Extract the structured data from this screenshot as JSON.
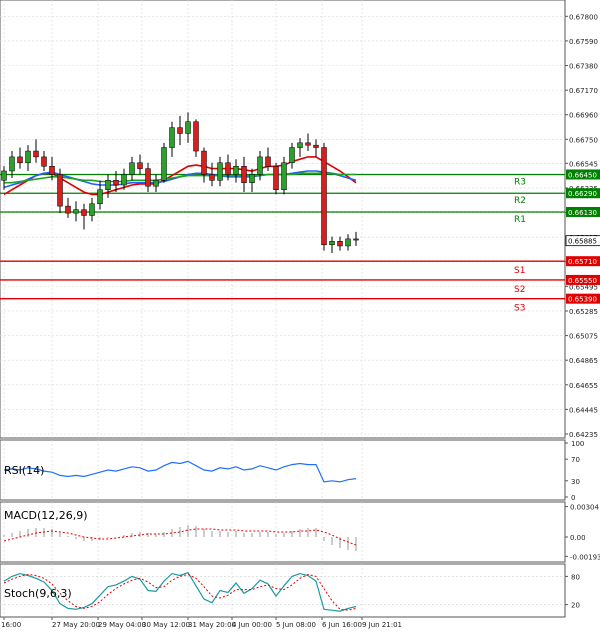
{
  "chart_data": {
    "type": "candlestick",
    "instrument_note": "",
    "price_axis": {
      "ticks": [
        "0.67800",
        "0.67590",
        "0.67380",
        "0.67170",
        "0.66960",
        "0.66750",
        "0.66545",
        "0.66335",
        "0.66125",
        "0.65915",
        "0.65705",
        "0.65495",
        "0.65285",
        "0.65075",
        "0.64865",
        "0.64655",
        "0.64445",
        "0.64235"
      ],
      "range": [
        0.64235,
        0.67905
      ],
      "current_price": "0.65885"
    },
    "levels": [
      {
        "label": "R3",
        "value": "0.66450",
        "color": "#008000"
      },
      {
        "label": "R2",
        "value": "0.66290",
        "color": "#008000"
      },
      {
        "label": "R1",
        "value": "0.66130",
        "color": "#008000"
      },
      {
        "label": "S1",
        "value": "0.65710",
        "color": "#e00000"
      },
      {
        "label": "S2",
        "value": "0.65550",
        "color": "#e00000"
      },
      {
        "label": "S3",
        "value": "0.65390",
        "color": "#e00000"
      }
    ],
    "time_axis": [
      "16:00",
      "27 May 20:00",
      "29 May 04:00",
      "30 May 12:00",
      "31 May 20:00",
      "4 Jun 00:00",
      "5 Jun 08:00",
      "6 Jun 16:00",
      "9 Jun 21:01"
    ],
    "candles": [
      [
        0.664,
        0.6652,
        0.6632,
        0.6648
      ],
      [
        0.6648,
        0.6665,
        0.6642,
        0.666
      ],
      [
        0.666,
        0.6668,
        0.665,
        0.6655
      ],
      [
        0.6655,
        0.667,
        0.6648,
        0.6665
      ],
      [
        0.6665,
        0.6675,
        0.6655,
        0.666
      ],
      [
        0.666,
        0.6665,
        0.6648,
        0.6652
      ],
      [
        0.6652,
        0.666,
        0.664,
        0.6645
      ],
      [
        0.6645,
        0.665,
        0.6612,
        0.6618
      ],
      [
        0.6618,
        0.6625,
        0.6608,
        0.6612
      ],
      [
        0.6612,
        0.6622,
        0.6605,
        0.6615
      ],
      [
        0.6615,
        0.662,
        0.6598,
        0.661
      ],
      [
        0.661,
        0.6625,
        0.6605,
        0.662
      ],
      [
        0.662,
        0.664,
        0.6615,
        0.6632
      ],
      [
        0.6632,
        0.6645,
        0.6625,
        0.664
      ],
      [
        0.664,
        0.6648,
        0.663,
        0.6636
      ],
      [
        0.6636,
        0.665,
        0.6632,
        0.6645
      ],
      [
        0.6645,
        0.666,
        0.664,
        0.6655
      ],
      [
        0.6655,
        0.6662,
        0.6645,
        0.665
      ],
      [
        0.665,
        0.6655,
        0.663,
        0.6635
      ],
      [
        0.6635,
        0.6645,
        0.663,
        0.664
      ],
      [
        0.664,
        0.6672,
        0.6638,
        0.6668
      ],
      [
        0.6668,
        0.669,
        0.666,
        0.6685
      ],
      [
        0.6685,
        0.6695,
        0.667,
        0.668
      ],
      [
        0.668,
        0.6698,
        0.6672,
        0.669
      ],
      [
        0.669,
        0.6692,
        0.666,
        0.6665
      ],
      [
        0.6665,
        0.6668,
        0.6638,
        0.6645
      ],
      [
        0.6645,
        0.6655,
        0.6635,
        0.664
      ],
      [
        0.664,
        0.666,
        0.6635,
        0.6655
      ],
      [
        0.6655,
        0.6662,
        0.664,
        0.6645
      ],
      [
        0.6645,
        0.6658,
        0.6638,
        0.6652
      ],
      [
        0.6652,
        0.666,
        0.663,
        0.6638
      ],
      [
        0.6638,
        0.665,
        0.663,
        0.6645
      ],
      [
        0.6645,
        0.6665,
        0.664,
        0.666
      ],
      [
        0.666,
        0.6668,
        0.6648,
        0.6652
      ],
      [
        0.6652,
        0.6655,
        0.6628,
        0.6632
      ],
      [
        0.6632,
        0.666,
        0.6628,
        0.6655
      ],
      [
        0.6655,
        0.6672,
        0.665,
        0.6668
      ],
      [
        0.6668,
        0.6676,
        0.666,
        0.6672
      ],
      [
        0.6672,
        0.668,
        0.6665,
        0.667
      ],
      [
        0.667,
        0.6675,
        0.666,
        0.6668
      ],
      [
        0.6668,
        0.6672,
        0.658,
        0.6585
      ],
      [
        0.6585,
        0.6592,
        0.6578,
        0.6588
      ],
      [
        0.6588,
        0.6592,
        0.658,
        0.6584
      ],
      [
        0.6584,
        0.6594,
        0.658,
        0.659
      ],
      [
        0.659,
        0.6596,
        0.6584,
        0.6589
      ]
    ],
    "moving_averages": [
      {
        "color": "#e00000",
        "values": [
          0.6628,
          0.6632,
          0.6636,
          0.664,
          0.6644,
          0.6646,
          0.6646,
          0.6642,
          0.6638,
          0.6634,
          0.663,
          0.6628,
          0.6628,
          0.663,
          0.6632,
          0.6634,
          0.6636,
          0.6637,
          0.6637,
          0.6637,
          0.664,
          0.6644,
          0.6648,
          0.6652,
          0.6653,
          0.6652,
          0.665,
          0.665,
          0.665,
          0.665,
          0.6649,
          0.6648,
          0.665,
          0.6652,
          0.6652,
          0.6653,
          0.6656,
          0.6658,
          0.666,
          0.666,
          0.6656,
          0.6652,
          0.6648,
          0.6643,
          0.6638
        ]
      },
      {
        "color": "#2060ff",
        "values": [
          0.6634,
          0.6636,
          0.6638,
          0.6641,
          0.6644,
          0.6646,
          0.6647,
          0.6645,
          0.6643,
          0.6641,
          0.6639,
          0.6637,
          0.6636,
          0.6636,
          0.6636,
          0.6637,
          0.6638,
          0.6638,
          0.6638,
          0.6638,
          0.6639,
          0.6641,
          0.6643,
          0.6645,
          0.6646,
          0.6646,
          0.6645,
          0.6644,
          0.6643,
          0.6643,
          0.6643,
          0.6643,
          0.6644,
          0.6645,
          0.6645,
          0.6645,
          0.6646,
          0.6647,
          0.6648,
          0.6648,
          0.6647,
          0.6646,
          0.6644,
          0.6642,
          0.664
        ]
      },
      {
        "color": "#20a020",
        "values": [
          0.6638,
          0.6638,
          0.6639,
          0.664,
          0.6641,
          0.6642,
          0.6643,
          0.6643,
          0.6642,
          0.6641,
          0.664,
          0.664,
          0.6639,
          0.6639,
          0.6639,
          0.6639,
          0.664,
          0.664,
          0.664,
          0.664,
          0.6641,
          0.6642,
          0.6643,
          0.6644,
          0.6644,
          0.6644,
          0.6644,
          0.6644,
          0.6644,
          0.6644,
          0.6644,
          0.6644,
          0.6644,
          0.6645,
          0.6645,
          0.6645,
          0.6645,
          0.6646,
          0.6646,
          0.6646,
          0.6646,
          0.6646,
          0.6645,
          0.6645,
          0.6645
        ]
      }
    ],
    "indicators": [
      {
        "name": "RSI(14)",
        "ticks": [
          "100",
          "70",
          "30",
          "0"
        ],
        "range": [
          0,
          100
        ],
        "color": "#2070ff",
        "values": [
          50,
          52,
          50,
          54,
          52,
          48,
          46,
          40,
          38,
          40,
          38,
          42,
          46,
          50,
          48,
          52,
          56,
          54,
          48,
          50,
          58,
          64,
          62,
          66,
          58,
          50,
          48,
          54,
          52,
          56,
          50,
          52,
          58,
          54,
          50,
          56,
          60,
          62,
          60,
          60,
          28,
          30,
          28,
          32,
          34
        ]
      },
      {
        "name": "MACD(12,26,9)",
        "ticks": [
          "0.00304",
          "0.00",
          "-0.001939"
        ],
        "range": [
          -0.0022,
          0.0032
        ],
        "hist_color": "#999999",
        "signal_color": "#e00000",
        "hist": [
          0.0002,
          0.0004,
          0.0006,
          0.0008,
          0.0009,
          0.0009,
          0.0008,
          0.0004,
          0.0001,
          -0.0002,
          -0.0004,
          -0.0004,
          -0.0003,
          -0.0001,
          0.0,
          0.0002,
          0.0004,
          0.0005,
          0.0004,
          0.0003,
          0.0005,
          0.0008,
          0.001,
          0.0012,
          0.0011,
          0.0008,
          0.0006,
          0.0006,
          0.0005,
          0.0006,
          0.0004,
          0.0004,
          0.0005,
          0.0005,
          0.0003,
          0.0004,
          0.0006,
          0.0008,
          0.0009,
          0.0009,
          -0.0004,
          -0.0008,
          -0.0011,
          -0.0013,
          -0.0014
        ],
        "signal": [
          -0.0004,
          -0.0002,
          0.0,
          0.0002,
          0.0004,
          0.0005,
          0.0006,
          0.0005,
          0.0004,
          0.0002,
          0.0,
          -0.0001,
          -0.0002,
          -0.0002,
          -0.0001,
          0.0,
          0.0001,
          0.0002,
          0.0003,
          0.0003,
          0.0003,
          0.0004,
          0.0005,
          0.0007,
          0.0008,
          0.0008,
          0.0008,
          0.0007,
          0.0007,
          0.0007,
          0.0006,
          0.0006,
          0.0006,
          0.0006,
          0.0005,
          0.0005,
          0.0005,
          0.0006,
          0.0006,
          0.0007,
          0.0005,
          0.0002,
          -0.0002,
          -0.0005,
          -0.0008
        ]
      },
      {
        "name": "Stoch(9,6,3)",
        "ticks": [
          "80",
          "20"
        ],
        "range": [
          0,
          100
        ],
        "main_color": "#1a9aa0",
        "signal_color": "#e00000",
        "main": [
          70,
          80,
          86,
          82,
          76,
          68,
          50,
          22,
          12,
          10,
          14,
          22,
          40,
          58,
          62,
          70,
          80,
          74,
          50,
          48,
          70,
          86,
          82,
          88,
          60,
          32,
          24,
          50,
          46,
          66,
          44,
          54,
          72,
          64,
          38,
          60,
          80,
          86,
          82,
          70,
          10,
          8,
          6,
          12,
          16
        ],
        "signal": [
          66,
          74,
          80,
          84,
          82,
          76,
          64,
          44,
          28,
          16,
          12,
          16,
          26,
          42,
          54,
          64,
          72,
          76,
          68,
          56,
          58,
          72,
          80,
          84,
          76,
          58,
          38,
          34,
          40,
          52,
          52,
          52,
          58,
          62,
          54,
          52,
          62,
          76,
          84,
          80,
          54,
          28,
          10,
          8,
          12
        ]
      }
    ]
  }
}
